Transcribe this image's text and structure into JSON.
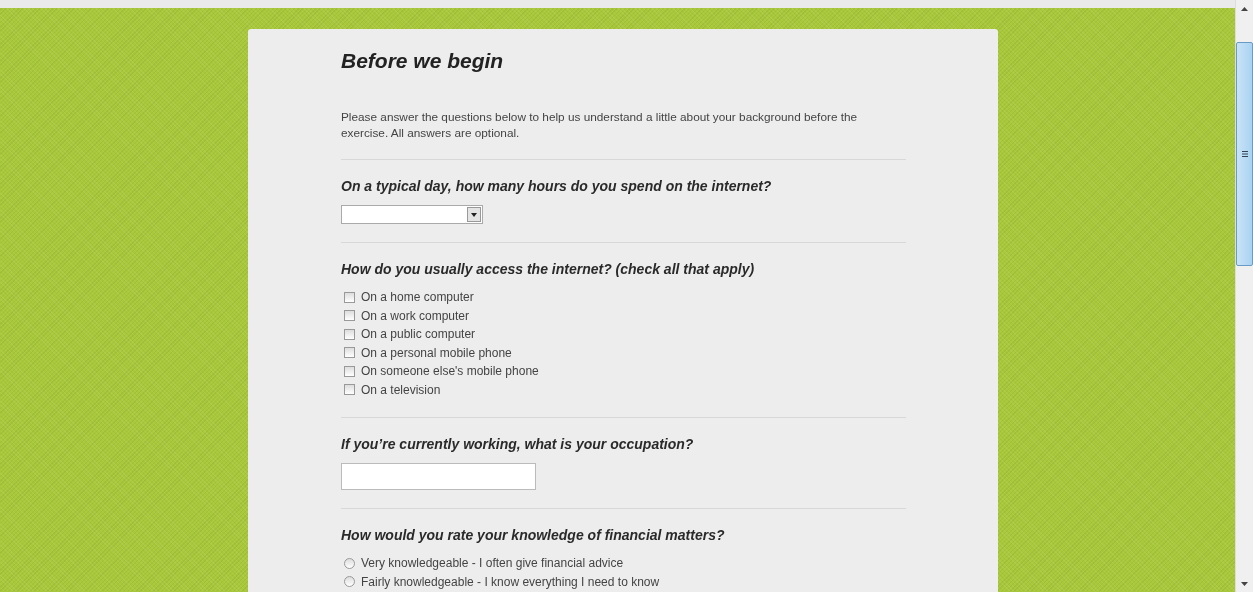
{
  "title": "Before we begin",
  "intro": "Please answer the questions below to help us understand a little about your background before the exercise. All answers are optional.",
  "questions": [
    {
      "kind": "select",
      "label": "On a typical day, how many hours do you spend on the internet?"
    },
    {
      "kind": "checkbox",
      "label": "How do you usually access the internet? (check all that apply)",
      "options": [
        {
          "label": "On a home computer",
          "checked": false
        },
        {
          "label": "On a work computer",
          "checked": false
        },
        {
          "label": "On a public computer",
          "checked": false
        },
        {
          "label": "On a personal mobile phone",
          "checked": false
        },
        {
          "label": "On someone else's mobile phone",
          "checked": false
        },
        {
          "label": "On a television",
          "checked": false
        }
      ]
    },
    {
      "kind": "text",
      "label": "If you’re currently working, what is your occupation?"
    },
    {
      "kind": "radio",
      "label": "How would you rate your knowledge of financial matters?",
      "options": [
        {
          "label": "Very knowledgeable - I often give financial advice",
          "selected": false
        },
        {
          "label": "Fairly knowledgeable - I know everything I need to know",
          "selected": false
        }
      ]
    }
  ]
}
